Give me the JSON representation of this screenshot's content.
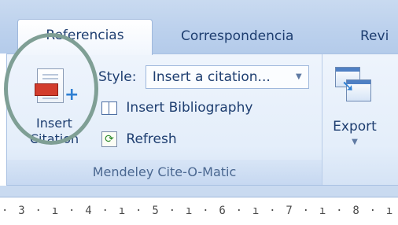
{
  "tabs": [
    {
      "label": "Referencias",
      "active": true
    },
    {
      "label": "Correspondencia",
      "active": false
    },
    {
      "label": "Revi",
      "active": false
    }
  ],
  "group": {
    "label": "Mendeley Cite-O-Matic",
    "insert_citation": {
      "line1": "Insert",
      "line2": "Citation"
    },
    "style": {
      "prefix": "Style:",
      "value": "Insert a citation..."
    },
    "insert_bibliography": "Insert Bibliography",
    "refresh": "Refresh"
  },
  "export": {
    "label": "Export"
  },
  "ruler": {
    "text": "· 3 · ı · 4 · ı · 5 · ı · 6 · ı · 7 · ı · 8 · ı"
  },
  "colors": {
    "tab_bg": "#c9daf0",
    "ribbon_bg": "#e4eefa",
    "text": "#1e3e70",
    "highlight_circle": "#7f9f95"
  },
  "icons": [
    "insert-citation-icon",
    "book-icon",
    "refresh-icon",
    "export-icon"
  ]
}
